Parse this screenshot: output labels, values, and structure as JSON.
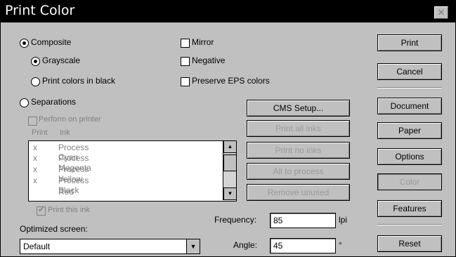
{
  "window": {
    "title": "Print Color",
    "close_symbol": "✕"
  },
  "composite": {
    "label": "Composite",
    "selected": true
  },
  "grayscale": {
    "label": "Grayscale",
    "selected": true
  },
  "print_black": {
    "label": "Print colors in black",
    "selected": false
  },
  "separations": {
    "label": "Separations",
    "selected": false
  },
  "perform_on_printer": {
    "label": "Perform on printer",
    "checked": false
  },
  "ink_headers": {
    "print": "Print",
    "ink": "Ink"
  },
  "inks": [
    {
      "print": "x",
      "name": "Process Cyan"
    },
    {
      "print": "x",
      "name": "Process Magenta"
    },
    {
      "print": "x",
      "name": "Process Yellow"
    },
    {
      "print": "x",
      "name": "Process Black"
    },
    {
      "print": "",
      "name": "Red"
    }
  ],
  "print_this_ink": {
    "label": "Print this ink",
    "checked": true
  },
  "optimized_screen": {
    "label": "Optimized screen:",
    "value": "Default"
  },
  "mirror": {
    "label": "Mirror",
    "checked": false
  },
  "negative": {
    "label": "Negative",
    "checked": false
  },
  "preserve_eps": {
    "label": "Preserve EPS colors",
    "checked": false
  },
  "mid_buttons": {
    "cms_setup": "CMS Setup...",
    "print_all_inks": "Print all inks",
    "print_no_inks": "Print no inks",
    "all_to_process": "All to process",
    "remove_unused": "Remove unused"
  },
  "frequency": {
    "label": "Frequency:",
    "value": "85",
    "unit": "lpi"
  },
  "angle": {
    "label": "Angle:",
    "value": "45",
    "unit": "°"
  },
  "right_buttons": {
    "print": "Print",
    "cancel": "Cancel",
    "document": "Document",
    "paper": "Paper",
    "options": "Options",
    "color": "Color",
    "features": "Features",
    "reset": "Reset"
  }
}
